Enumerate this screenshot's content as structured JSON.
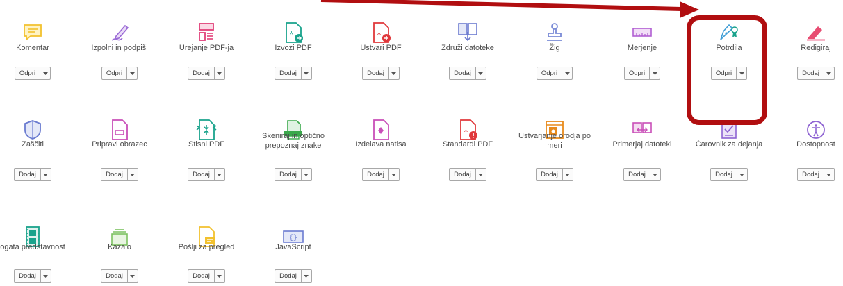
{
  "colors": {
    "accent_arrow": "#b10e10",
    "comment": "#f6c532",
    "fill_sign": "#9b6cd6",
    "edit_pdf": "#e8417a",
    "export_pdf": "#1aa38c",
    "create_pdf": "#e0383b",
    "combine": "#6d7dcc",
    "stamp": "#7b8fd6",
    "measure": "#b15fd2",
    "certificates": "#3b9bd4",
    "redact": "#e84d72"
  },
  "tools": [
    {
      "label": "Komentar",
      "button": "Odpri",
      "icon": "comment-icon",
      "color": "#f2c12e"
    },
    {
      "label": "Izpolni in podpiši",
      "button": "Odpri",
      "icon": "fill-sign-icon",
      "color": "#9a6ad6"
    },
    {
      "label": "Urejanje PDF-ja",
      "button": "Dodaj",
      "icon": "edit-pdf-icon",
      "color": "#e23f78"
    },
    {
      "label": "Izvozi PDF",
      "button": "Dodaj",
      "icon": "export-pdf-icon",
      "color": "#1aa38c"
    },
    {
      "label": "Ustvari PDF",
      "button": "Dodaj",
      "icon": "create-pdf-icon",
      "color": "#e0383b"
    },
    {
      "label": "Združi datoteke",
      "button": "Dodaj",
      "icon": "combine-files-icon",
      "color": "#6c7bd0"
    },
    {
      "label": "Žig",
      "button": "Odpri",
      "icon": "stamp-icon",
      "color": "#7a8bd6"
    },
    {
      "label": "Merjenje",
      "button": "Odpri",
      "icon": "measure-icon",
      "color": "#b15fd2"
    },
    {
      "label": "Potrdila",
      "button": "Odpri",
      "icon": "certificates-icon",
      "color": "#3e9dd6"
    },
    {
      "label": "Redigiraj",
      "button": "Dodaj",
      "icon": "redact-icon",
      "color": "#e84d72"
    },
    {
      "label": "Zaščiti",
      "button": "Dodaj",
      "icon": "protect-icon",
      "color": "#6a7bd0"
    },
    {
      "label": "Pripravi obrazec",
      "button": "Dodaj",
      "icon": "prepare-form-icon",
      "color": "#c94fb8"
    },
    {
      "label": "Stisni PDF",
      "button": "Dodaj",
      "icon": "compress-pdf-icon",
      "color": "#1aa38c"
    },
    {
      "label": "Skeniraj in optično prepoznaj znake",
      "button": "Dodaj",
      "icon": "scan-ocr-icon",
      "color": "#3aa84a"
    },
    {
      "label": "Izdelava natisa",
      "button": "Dodaj",
      "icon": "print-production-icon",
      "color": "#c94fb8"
    },
    {
      "label": "Standardi PDF",
      "button": "Dodaj",
      "icon": "pdf-standards-icon",
      "color": "#e0383b"
    },
    {
      "label": "Ustvarjanje orodja po meri",
      "button": "Dodaj",
      "icon": "custom-tool-icon",
      "color": "#e88a1c"
    },
    {
      "label": "Primerjaj datoteki",
      "button": "Dodaj",
      "icon": "compare-files-icon",
      "color": "#c94fb8"
    },
    {
      "label": "Čarovnik za dejanja",
      "button": "Dodaj",
      "icon": "action-wizard-icon",
      "color": "#8e63d2"
    },
    {
      "label": "Dostopnost",
      "button": "Dodaj",
      "icon": "accessibility-icon",
      "color": "#8e63d2"
    },
    {
      "label": "ogata predstavnost",
      "button": "Dodaj",
      "icon": "rich-media-icon",
      "color": "#1aa38c"
    },
    {
      "label": "Kazalo",
      "button": "Dodaj",
      "icon": "index-icon",
      "color": "#7cc160"
    },
    {
      "label": "Pošlji za pregled",
      "button": "Dodaj",
      "icon": "send-for-review-icon",
      "color": "#f2c12e"
    },
    {
      "label": "JavaScript",
      "button": "Dodaj",
      "icon": "javascript-icon",
      "color": "#6a7bd0"
    }
  ]
}
